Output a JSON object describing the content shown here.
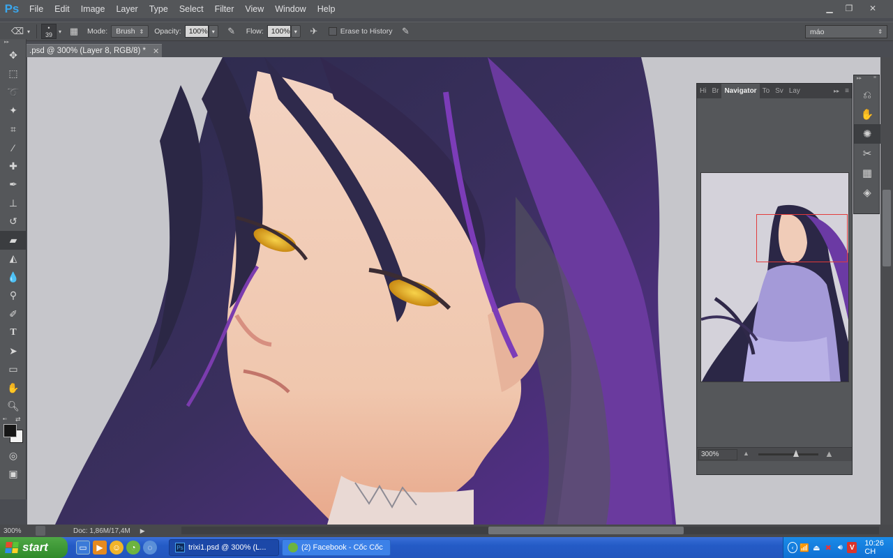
{
  "app": {
    "logo": "Ps"
  },
  "menu": [
    "File",
    "Edit",
    "Image",
    "Layer",
    "Type",
    "Select",
    "Filter",
    "View",
    "Window",
    "Help"
  ],
  "options": {
    "brush_size": "39",
    "mode_label": "Mode:",
    "mode_value": "Brush",
    "opacity_label": "Opacity:",
    "opacity_value": "100%",
    "flow_label": "Flow:",
    "flow_value": "100%",
    "erase_history_label": "Erase to History",
    "workspace": "máo"
  },
  "document": {
    "tab_title": ".psd @ 300% (Layer 8, RGB/8) *",
    "zoom": "300%",
    "doc_info": "Doc: 1,86M/17,4M"
  },
  "navigator": {
    "tabs": [
      "Hi",
      "Br",
      "Navigator",
      "To",
      "Sv",
      "Lay"
    ],
    "zoom_value": "300%"
  },
  "taskbar": {
    "start_label": "start",
    "tasks": [
      "trixi1.psd @ 300% (L...",
      "(2) Facebook - Cốc Cốc"
    ],
    "clock": "10:26 CH"
  }
}
